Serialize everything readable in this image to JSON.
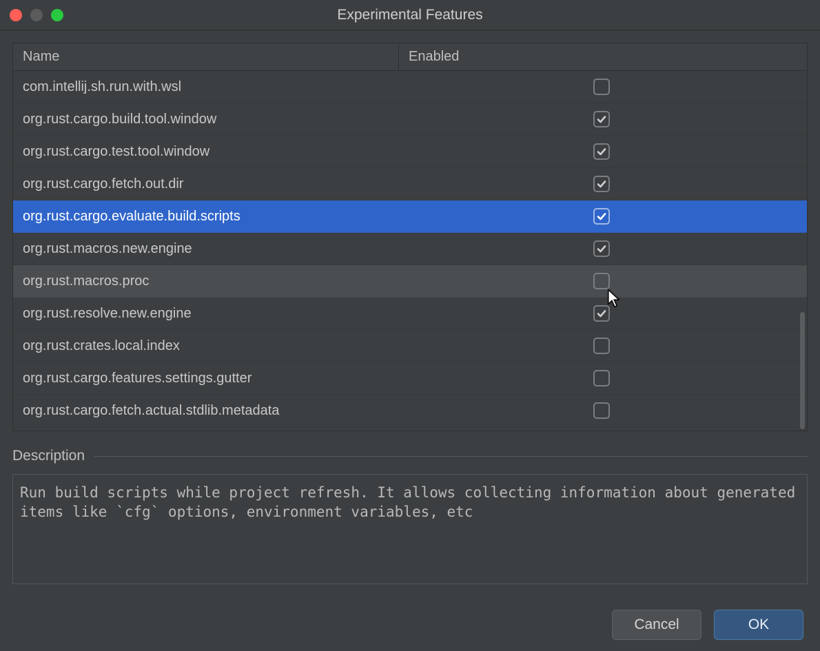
{
  "window": {
    "title": "Experimental Features"
  },
  "table": {
    "columns": {
      "name": "Name",
      "enabled": "Enabled"
    },
    "rows": [
      {
        "name": "com.intellij.sh.run.with.wsl",
        "enabled": false,
        "selected": false,
        "hovered": false
      },
      {
        "name": "org.rust.cargo.build.tool.window",
        "enabled": true,
        "selected": false,
        "hovered": false
      },
      {
        "name": "org.rust.cargo.test.tool.window",
        "enabled": true,
        "selected": false,
        "hovered": false
      },
      {
        "name": "org.rust.cargo.fetch.out.dir",
        "enabled": true,
        "selected": false,
        "hovered": false
      },
      {
        "name": "org.rust.cargo.evaluate.build.scripts",
        "enabled": true,
        "selected": true,
        "hovered": false
      },
      {
        "name": "org.rust.macros.new.engine",
        "enabled": true,
        "selected": false,
        "hovered": false
      },
      {
        "name": "org.rust.macros.proc",
        "enabled": false,
        "selected": false,
        "hovered": true
      },
      {
        "name": "org.rust.resolve.new.engine",
        "enabled": true,
        "selected": false,
        "hovered": false
      },
      {
        "name": "org.rust.crates.local.index",
        "enabled": false,
        "selected": false,
        "hovered": false
      },
      {
        "name": "org.rust.cargo.features.settings.gutter",
        "enabled": false,
        "selected": false,
        "hovered": false
      },
      {
        "name": "org.rust.cargo.fetch.actual.stdlib.metadata",
        "enabled": false,
        "selected": false,
        "hovered": false
      }
    ]
  },
  "description": {
    "label": "Description",
    "text": "Run build scripts while project refresh. It allows collecting information about generated items like `cfg` options, environment variables, etc"
  },
  "buttons": {
    "cancel": "Cancel",
    "ok": "OK"
  }
}
